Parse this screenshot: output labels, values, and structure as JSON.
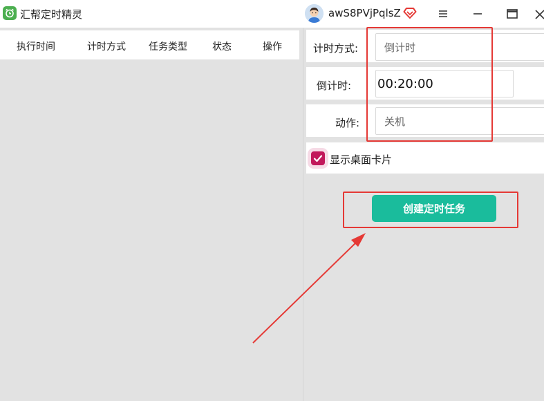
{
  "app": {
    "title": "汇帮定时精灵",
    "icon": "alarm-clock-icon"
  },
  "user": {
    "name": "awS8PVjPqlsZ",
    "avatar": "avatar-icon",
    "badge": "vip-diamond-icon"
  },
  "window_controls": [
    "menu-icon",
    "minimize-icon",
    "maximize-icon",
    "close-icon"
  ],
  "table": {
    "columns": [
      "执行时间",
      "计时方式",
      "任务类型",
      "状态",
      "操作"
    ]
  },
  "form": {
    "timing_mode": {
      "label": "计时方式:",
      "value": "倒计时"
    },
    "countdown": {
      "label": "倒计时:",
      "value": "00:20:00"
    },
    "action": {
      "label": "动作:",
      "value": "关机"
    },
    "show_card": {
      "label": "显示桌面卡片",
      "checked": true
    },
    "create_button": "创建定时任务"
  },
  "colors": {
    "accent": "#1abc9c",
    "checkbox": "#c2185b",
    "annotation": "#e53935",
    "panel": "#e2e2e2"
  }
}
